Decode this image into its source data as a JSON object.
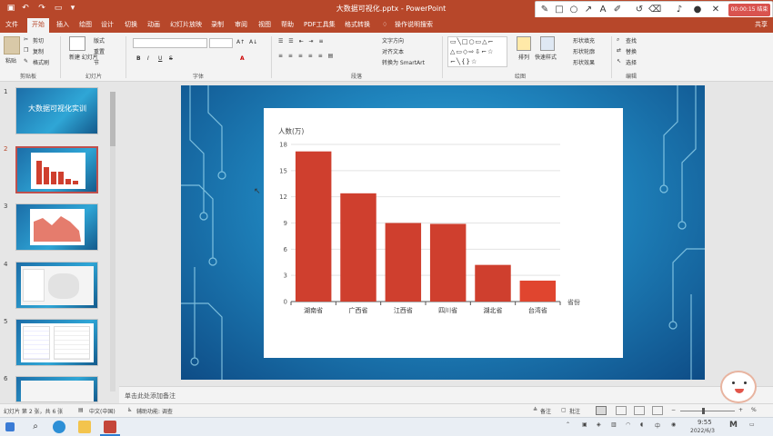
{
  "app": {
    "document_title": "大数据可视化.pptx - PowerPoint",
    "recording_timer": "00:00:15 结束",
    "share_label": "共享"
  },
  "menu": {
    "tabs": [
      "文件",
      "开始",
      "插入",
      "绘图",
      "设计",
      "切换",
      "动画",
      "幻灯片放映",
      "录制",
      "审阅",
      "视图",
      "帮助",
      "PDF工具集",
      "格式转换",
      "操作说明搜索"
    ],
    "active": "开始"
  },
  "ribbon": {
    "clipboard": {
      "paste": "粘贴",
      "cut": "剪切",
      "copy": "复制",
      "format_painter": "格式刷",
      "group": "剪贴板"
    },
    "slides": {
      "new_slide": "新建\n幻灯片",
      "layout": "版式",
      "reset": "重置",
      "section": "节",
      "group": "幻灯片"
    },
    "font": {
      "bold": "B",
      "italic": "I",
      "underline": "U",
      "strike": "S",
      "group": "字体"
    },
    "paragraph": {
      "text_direction": "文字方向",
      "align_text": "对齐文本",
      "smartart": "转换为 SmartArt",
      "group": "段落"
    },
    "drawing": {
      "arrange": "排列",
      "quick_styles": "快速样式",
      "shape_fill": "形状填充",
      "shape_outline": "形状轮廓",
      "shape_effects": "形状效果",
      "group": "绘图"
    },
    "editing": {
      "find": "查找",
      "replace": "替换",
      "select": "选择",
      "group": "编辑"
    }
  },
  "thumbnails": [
    {
      "num": "1",
      "title": "大数据可视化实训"
    },
    {
      "num": "2"
    },
    {
      "num": "3"
    },
    {
      "num": "4"
    },
    {
      "num": "5"
    },
    {
      "num": "6"
    }
  ],
  "chart_data": {
    "type": "bar",
    "ylabel": "人数(万)",
    "xlabel": "省份",
    "categories": [
      "湖南省",
      "广西省",
      "江西省",
      "四川省",
      "湖北省",
      "台湾省"
    ],
    "values": [
      17.2,
      12.4,
      9.0,
      8.9,
      4.2,
      2.4
    ],
    "ylim": [
      0,
      18
    ],
    "yticks": [
      "0",
      "3",
      "6",
      "9",
      "12",
      "15",
      "18"
    ],
    "colors": {
      "bar": "#cf3f2e",
      "bar_last": "#e0452f"
    },
    "grid": true
  },
  "notes": {
    "placeholder": "单击此处添加备注"
  },
  "status": {
    "slide_info": "幻灯片 第 2 张，共 6 张",
    "language": "中文(中国)",
    "accessibility": "辅助功能: 调查",
    "notes_btn": "备注",
    "comments_btn": "批注",
    "zoom": "%"
  },
  "taskbar": {
    "time": "9:55",
    "date": "2022/6/3"
  }
}
